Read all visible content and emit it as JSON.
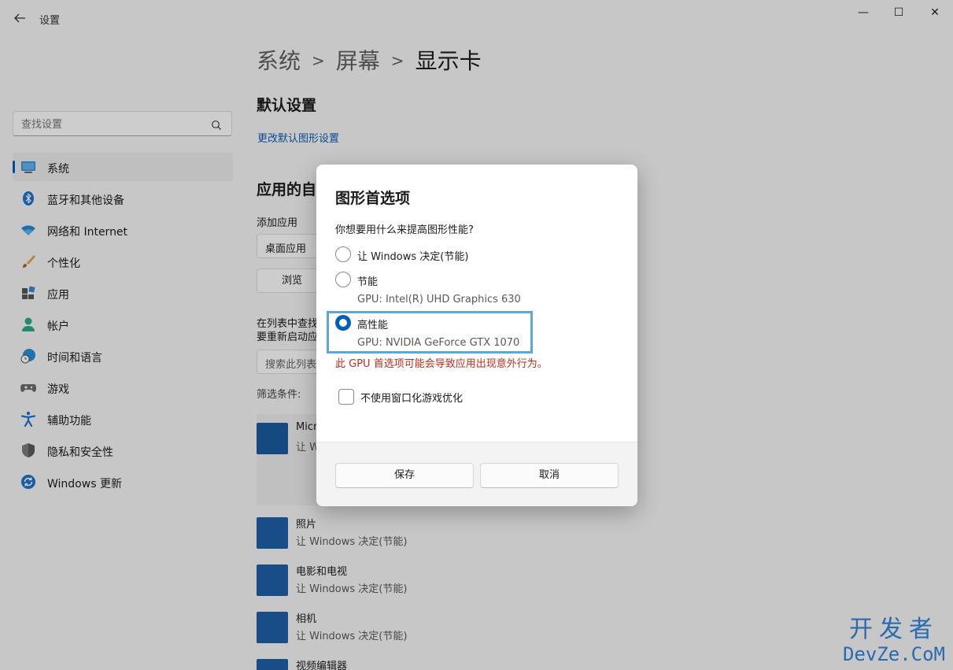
{
  "window": {
    "title": "设置",
    "minimize": "—",
    "maximize": "☐",
    "close": "✕"
  },
  "search": {
    "placeholder": "查找设置"
  },
  "sidebar": {
    "items": [
      {
        "label": "系统",
        "icon": "system-icon"
      },
      {
        "label": "蓝牙和其他设备",
        "icon": "bluetooth-icon"
      },
      {
        "label": "网络和 Internet",
        "icon": "wifi-icon"
      },
      {
        "label": "个性化",
        "icon": "brush-icon"
      },
      {
        "label": "应用",
        "icon": "apps-icon"
      },
      {
        "label": "帐户",
        "icon": "account-icon"
      },
      {
        "label": "时间和语言",
        "icon": "time-language-icon"
      },
      {
        "label": "游戏",
        "icon": "gaming-icon"
      },
      {
        "label": "辅助功能",
        "icon": "accessibility-icon"
      },
      {
        "label": "隐私和安全性",
        "icon": "shield-icon"
      },
      {
        "label": "Windows 更新",
        "icon": "update-icon"
      }
    ]
  },
  "main": {
    "breadcrumb": [
      "系统",
      "屏幕",
      "显示卡"
    ],
    "default_settings_heading": "默认设置",
    "change_default_link": "更改默认图形设置",
    "app_custom_heading": "应用的自",
    "add_app_label": "添加应用",
    "app_type_select": "桌面应用",
    "browse_button": "浏览",
    "list_hint_line1": "在列表中查找",
    "list_hint_line2": "要重新启动应",
    "list_search_placeholder": "搜索此列表",
    "filter_label": "筛选条件:",
    "apps": [
      {
        "name": "Micr",
        "sub": "让 W"
      },
      {
        "name": "照片",
        "sub": "让 Windows 决定(节能)"
      },
      {
        "name": "电影和电视",
        "sub": "让 Windows 决定(节能)"
      },
      {
        "name": "相机",
        "sub": "让 Windows 决定(节能)"
      },
      {
        "name": "视频编辑器",
        "sub": ""
      }
    ]
  },
  "dialog": {
    "title": "图形首选项",
    "question": "你想要用什么来提高图形性能?",
    "options": [
      {
        "label": "让 Windows 决定(节能)",
        "gpu": "",
        "checked": false
      },
      {
        "label": "节能",
        "gpu": "GPU: Intel(R) UHD Graphics 630",
        "checked": false
      },
      {
        "label": "高性能",
        "gpu": "GPU: NVIDIA GeForce GTX 1070",
        "checked": true
      }
    ],
    "warning": "此 GPU 首选项可能会导致应用出现意外行为。",
    "checkbox_label": "不使用窗口化游戏优化",
    "checkbox_checked": false,
    "save_button": "保存",
    "cancel_button": "取消",
    "accent_color": "#005fb8",
    "warning_color": "#c42b1c"
  },
  "watermark": {
    "line1": "开发者",
    "line2": "DevZe.CoM"
  }
}
